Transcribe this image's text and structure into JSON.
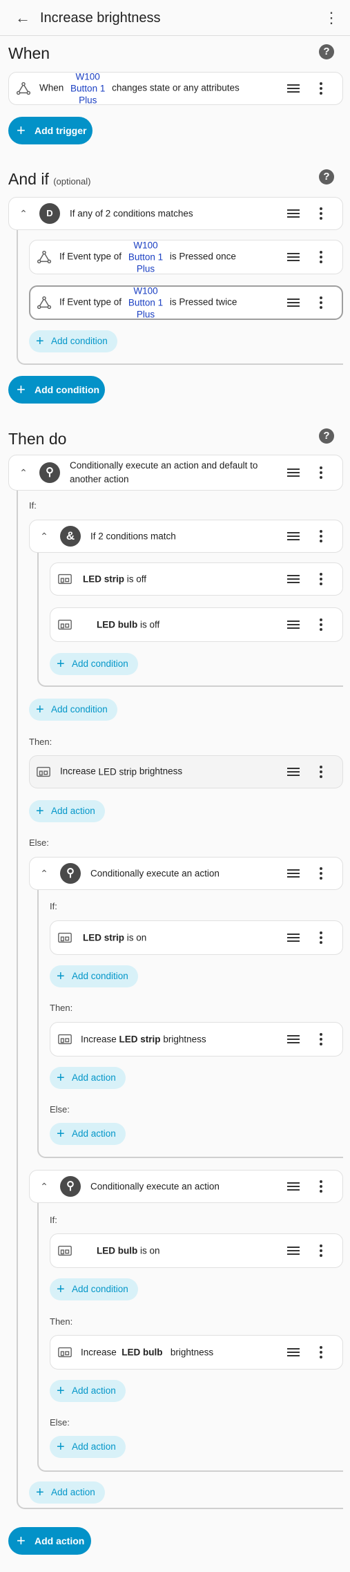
{
  "app": {
    "title": "Increase brightness"
  },
  "when": {
    "title": "When",
    "trigger": {
      "prefix": "When",
      "entity_l1": "W100",
      "entity_l2": "Button 1",
      "entity_l3": "Plus",
      "suffix": "changes state or any attributes"
    },
    "add_trigger": "Add trigger"
  },
  "and_if": {
    "title": "And if",
    "optional": "(optional)",
    "group_label": "If any of 2 conditions matches",
    "cond1": {
      "prefix": "If Event type of",
      "entity_l1": "W100",
      "entity_l2": "Button 1",
      "entity_l3": "Plus",
      "suffix": "is Pressed once"
    },
    "cond2": {
      "prefix": "If Event type of",
      "entity_l1": "W100",
      "entity_l2": "Button 1",
      "entity_l3": "Plus",
      "suffix": "is Pressed twice"
    },
    "inner_add_condition": "Add condition",
    "add_condition": "Add condition"
  },
  "then_do": {
    "title": "Then do",
    "choose": {
      "label_l1": "Conditionally execute an action and default to",
      "label_l2": "another action",
      "if_label": "If:",
      "and_group": "If 2 conditions match",
      "c1": {
        "entity": "LED strip",
        "state": "is off"
      },
      "c2": {
        "entity": "LED bulb",
        "state": "is off"
      },
      "inner_add_condition": "Add condition",
      "add_condition": "Add condition",
      "then_label": "Then:",
      "then_action": {
        "prefix": "Increase",
        "entity": "LED strip",
        "suffix": "brightness"
      },
      "then_add_action": "Add action",
      "else_label": "Else:",
      "b1": {
        "label": "Conditionally execute an action",
        "if_label": "If:",
        "cond": {
          "entity": "LED strip",
          "state": "is on"
        },
        "add_condition": "Add condition",
        "then_label": "Then:",
        "action": {
          "prefix": "Increase",
          "entity": "LED strip",
          "suffix": "brightness"
        },
        "add_action": "Add action",
        "else_label": "Else:",
        "else_add_action": "Add action"
      },
      "b2": {
        "label": "Conditionally execute an action",
        "if_label": "If:",
        "cond": {
          "entity": "LED bulb",
          "state": "is on"
        },
        "add_condition": "Add condition",
        "then_label": "Then:",
        "action": {
          "prefix": "Increase",
          "entity": "LED bulb",
          "suffix": "brightness"
        },
        "add_action": "Add action",
        "else_label": "Else:",
        "else_add_action": "Add action"
      },
      "else_add_action": "Add action"
    },
    "add_action": "Add action"
  },
  "icons": {
    "back": "arrow-left-icon",
    "menu": "dots-vertical-icon",
    "help": "help-circle-icon",
    "trigger": "state-change-icon",
    "drag": "drag-handle-icon",
    "device": "device-icon",
    "or": "or-gate-icon",
    "and": "ampersand-icon",
    "choose": "branch-icon",
    "chevron": "chevron-up-icon",
    "plus": "plus-icon"
  },
  "colors": {
    "primary": "#0392c8",
    "tonal": "#d8f1f8",
    "entity": "#1a3fc2"
  }
}
